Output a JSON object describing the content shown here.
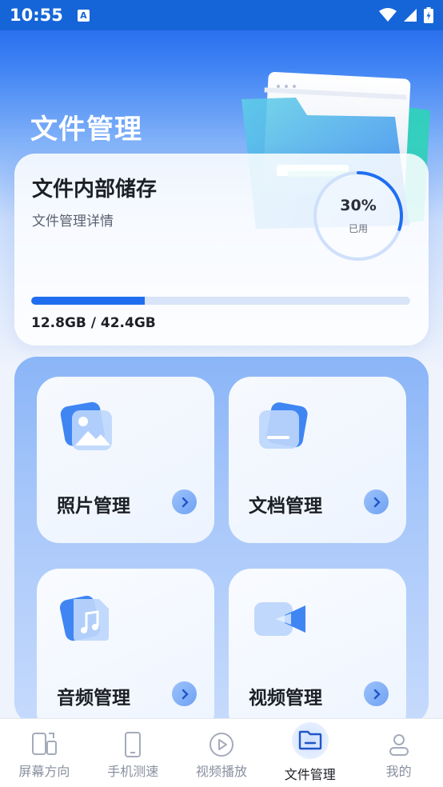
{
  "status_bar": {
    "time": "10:55",
    "left_icon": "A",
    "icons": [
      "wifi-icon",
      "signal-icon",
      "battery-icon"
    ]
  },
  "header": {
    "title": "文件管理"
  },
  "storage": {
    "title": "文件内部储存",
    "subtitle": "文件管理详情",
    "percent_label": "30%",
    "used_label": "已用",
    "used_fraction": 0.3,
    "amount": "12.8GB / 42.4GB"
  },
  "tiles": [
    {
      "label": "照片管理",
      "icon": "photo-icon"
    },
    {
      "label": "文档管理",
      "icon": "document-icon"
    },
    {
      "label": "音频管理",
      "icon": "music-icon"
    },
    {
      "label": "视频管理",
      "icon": "video-icon"
    }
  ],
  "nav": [
    {
      "label": "屏幕方向",
      "icon": "screen-rotate-icon"
    },
    {
      "label": "手机测速",
      "icon": "phone-icon"
    },
    {
      "label": "视频播放",
      "icon": "play-icon"
    },
    {
      "label": "文件管理",
      "icon": "folder-icon",
      "active": true
    },
    {
      "label": "我的",
      "icon": "user-icon"
    }
  ],
  "colors": {
    "accent": "#1f6ef0",
    "status_bar": "#1565d8"
  }
}
